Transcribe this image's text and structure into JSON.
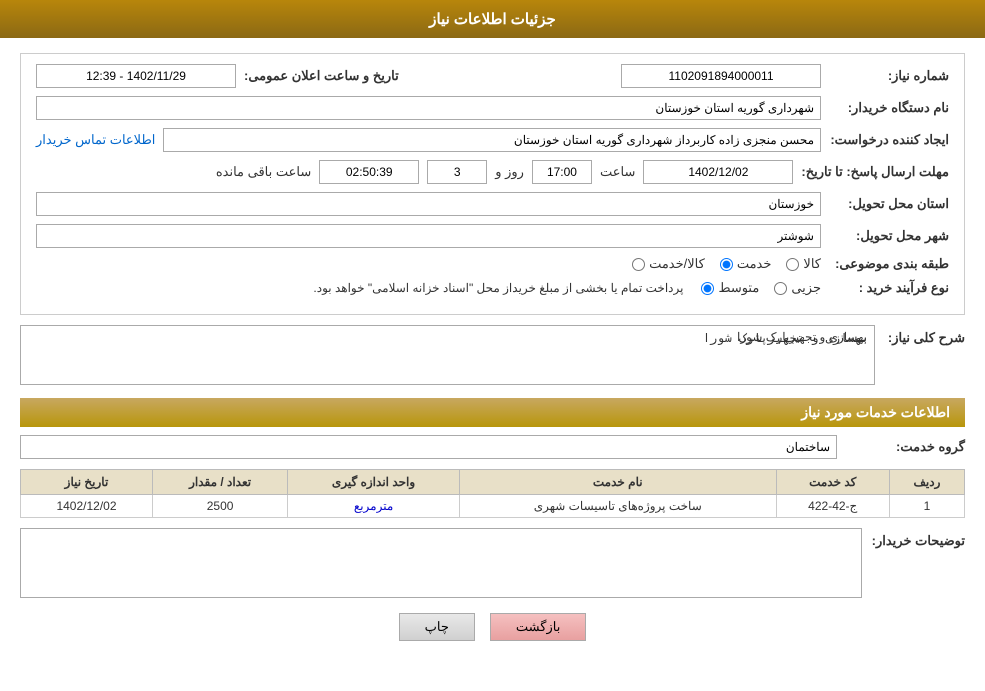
{
  "header": {
    "title": "جزئیات اطلاعات نیاز"
  },
  "fields": {
    "shomara_niaz_label": "شماره نیاز:",
    "shomara_niaz_value": "1102091894000011",
    "name_dastgah_label": "نام دستگاه خریدار:",
    "name_dastgah_value": "شهرداری گوریه استان خوزستان",
    "ijad_label": "ایجاد کننده درخواست:",
    "ijad_value": "محسن منجزی زاده کاربرداز شهرداری گوریه استان خوزستان",
    "ejad_link": "اطلاعات تماس خریدار",
    "mohlet_label": "مهلت ارسال پاسخ: تا تاریخ:",
    "mohlet_date": "1402/12/02",
    "mohlet_saat_label": "ساعت",
    "mohlet_saat_value": "17:00",
    "mohlet_roz_label": "روز و",
    "mohlet_roz_value": "3",
    "mohlet_remaining_label": "ساعت باقی مانده",
    "mohlet_remaining_value": "02:50:39",
    "ostan_label": "استان محل تحویل:",
    "ostan_value": "خوزستان",
    "shahr_label": "شهر محل تحویل:",
    "shahr_value": "شوشتر",
    "tabaqeh_label": "طبقه بندی موضوعی:",
    "tabaqeh_options": [
      {
        "id": "kala",
        "label": "کالا"
      },
      {
        "id": "khadamat",
        "label": "خدمت"
      },
      {
        "id": "kala_khadamat",
        "label": "کالا/خدمت"
      }
    ],
    "tabaqeh_selected": "khadamat",
    "nav_farayand_label": "نوع فرآیند خرید :",
    "nav_farayand_options": [
      {
        "id": "jozi",
        "label": "جزیی"
      },
      {
        "id": "motavaset",
        "label": "متوسط"
      }
    ],
    "nav_farayand_selected": "motavaset",
    "nav_farayand_notice": "پرداخت تمام یا بخشی از مبلغ خریداز محل \"اسناد خزانه اسلامی\" خواهد بود.",
    "tarikh_vaelam_label": "تاریخ و ساعت اعلان عمومی:",
    "tarikh_vaelam_value": "1402/11/29 - 12:39",
    "sharh_label": "شرح کلی نیاز:",
    "sharh_value": "بهسازی و تجهیزپارک شورا"
  },
  "services_section": {
    "title": "اطلاعات خدمات مورد نیاز",
    "group_label": "گروه خدمت:",
    "group_value": "ساختمان",
    "table": {
      "headers": [
        "ردیف",
        "کد خدمت",
        "نام خدمت",
        "واحد اندازه گیری",
        "تعداد / مقدار",
        "تاریخ نیاز"
      ],
      "rows": [
        {
          "radif": "1",
          "kod_khadamat": "ج-42-422",
          "name_khadamat": "ساخت پروژه‌های تاسیسات شهری",
          "vahed": "مترمربع",
          "tedad": "2500",
          "tarikh": "1402/12/02"
        }
      ]
    }
  },
  "description": {
    "label": "توضیحات خریدار:",
    "value": ""
  },
  "buttons": {
    "print": "چاپ",
    "back": "بازگشت"
  }
}
